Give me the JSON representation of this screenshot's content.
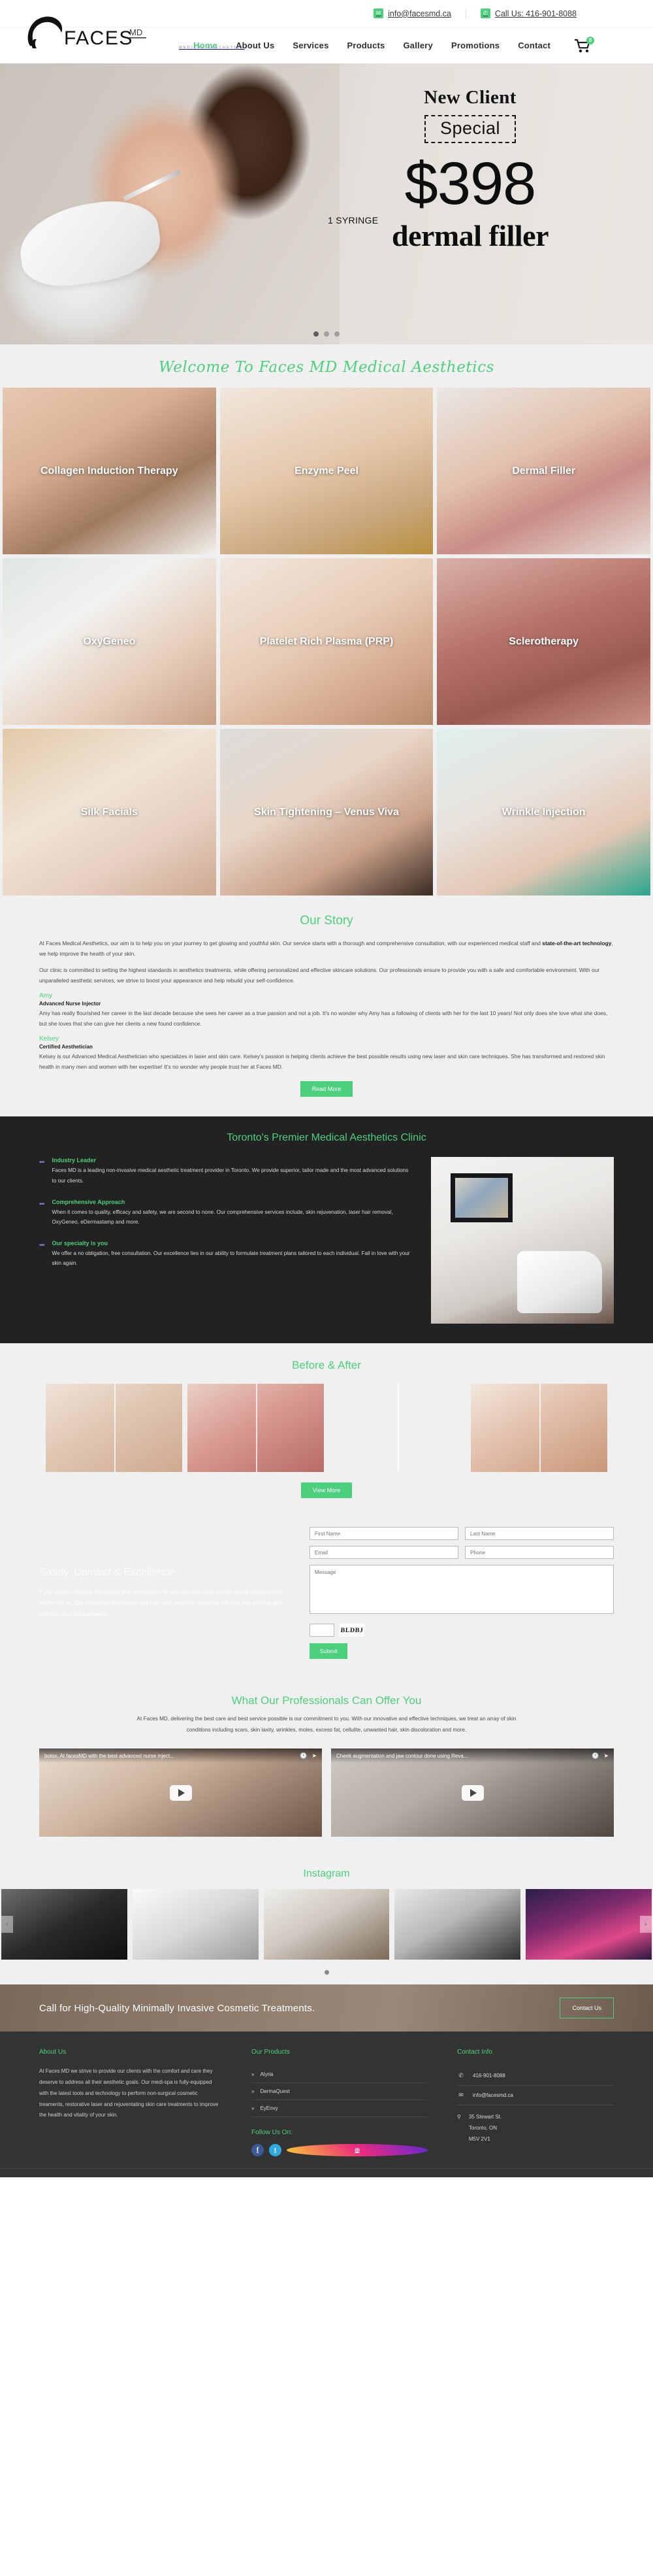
{
  "topbar": {
    "email": "info@facesmd.ca",
    "phone": "Call Us: 416-901-8088",
    "email_icon": "envelope-icon",
    "phone_icon": "phone-icon"
  },
  "brand": {
    "name": "FACES",
    "superscript": "MD",
    "tagline": "MEDICAL AESTHETICS"
  },
  "nav": {
    "items": [
      {
        "label": "Home",
        "active": true
      },
      {
        "label": "About Us",
        "active": false
      },
      {
        "label": "Services",
        "active": false
      },
      {
        "label": "Products",
        "active": false
      },
      {
        "label": "Gallery",
        "active": false
      },
      {
        "label": "Promotions",
        "active": false
      },
      {
        "label": "Contact",
        "active": false
      }
    ],
    "cart_count": "0"
  },
  "hero": {
    "kicker": "New Client",
    "special": "Special",
    "price": "$398",
    "syringe": "1 SYRINGE",
    "product": "dermal filler",
    "slides": 3,
    "active_slide": 1
  },
  "welcome": {
    "heading": "Welcome To Faces MD Medical Aesthetics"
  },
  "services": [
    {
      "label": "Collagen Induction Therapy"
    },
    {
      "label": "Enzyme Peel"
    },
    {
      "label": "Dermal Filler"
    },
    {
      "label": "OxyGeneo"
    },
    {
      "label": "Platelet Rich Plasma (PRP)"
    },
    {
      "label": "Sclerotherapy"
    },
    {
      "label": "Silk Facials"
    },
    {
      "label": "Skin Tightening – Venus Viva"
    },
    {
      "label": "Wrinkle Injection"
    }
  ],
  "story": {
    "title": "Our Story",
    "p1_a": "At Faces Medical Aesthetics, our aim is to help you on your journey to get glowing and youthful skin. Our service starts with a thorough and comprehensive consultation, with our experienced medical staff and ",
    "p1_b": "state-of-the-art technology",
    "p1_c": ", we help improve the health of your skin.",
    "p2": "Our clinic is committed to setting the highest standards in aesthetics treatments, while offering personalized and effective skincare solutions. Our professionals ensure to provide you with a safe and comfortable environment. With our unparalleled aesthetic services, we strive to boost your appearance and help rebuild your self-confidence.",
    "amy_name": "Amy",
    "amy_role": "Advanced Nurse Injector",
    "amy_bio": "Amy has really flourished her career in the last decade because she sees her career as a true passion and not a job. It's no wonder why Amy has a following of clients with her for the last 10 years! Not only does she love what she does, but she loves that she can give her clients a new found confidence.",
    "kelsey_name": "Kelsey",
    "kelsey_role": "Certified Aesthetician",
    "kelsey_bio": "Kelsey is our Advanced Medical Aesthetician who specializes in laser and skin care. Kelsey's passion is helping clients achieve the best possible results using new laser and skin care techniques. She has transformed and restored skin health in many men and women with her expertise! It's no wonder why people trust her at Faces MD.",
    "read_more": "Read More"
  },
  "premier": {
    "title": "Toronto's Premier Medical Aesthetics Clinic",
    "features": [
      {
        "heading": "Industry Leader",
        "body": "Faces MD is a leading non-invasive medical aesthetic treatment provider in Toronto. We provide superior, tailor made and the most advanced solutions to our clients."
      },
      {
        "heading": "Comprehensive Approach",
        "body": "When it comes to quality, efficacy and safety, we are second to none. Our comprehensive services include, skin rejuvenation, laser hair removal, OxyGeneo, eDermastamp and more."
      },
      {
        "heading": "Our specialty is you",
        "body": "We offer a no obligation, free consultation. Our excellence lies in our ability to formulate treatment plans tailored to each individual. Fall in love with your skin again."
      }
    ]
  },
  "before_after": {
    "title": "Before & After",
    "view_more": "View More",
    "cards": 4
  },
  "safety": {
    "title": "Safety, Comfort & Excellence",
    "body": "If you want to improve the texture and appearance of your skin and want to look young and beautiful, kindly visit us. Our innovative techniques and high-tech aesthetic expertise will help you achieve and maintain your natural beauty."
  },
  "form": {
    "first_name_placeholder": "First Name",
    "last_name_placeholder": "Last Name",
    "email_placeholder": "Email",
    "phone_placeholder": "Phone",
    "message_placeholder": "Message",
    "first_name_value": "",
    "last_name_value": "",
    "email_value": "",
    "phone_value": "",
    "message_value": "",
    "captcha_value": "",
    "captcha_text": "BLDBJ",
    "submit_label": "Submit"
  },
  "offer": {
    "title": "What Our Professionals Can Offer You",
    "body": "At Faces MD, delivering the best care and best service possible is our commitment to you. With our innovative and effective techniques, we treat an array of skin conditions including scars, skin laxity, wrinkles, moles, excess fat, cellulite, unwanted hair, skin discoloration and more.",
    "videos": [
      {
        "title": "botox, At facesMD with the best advanced nurse inject..."
      },
      {
        "title": "Cheek augmentation and jaw contour done using Reva..."
      }
    ]
  },
  "instagram": {
    "title": "Instagram",
    "prev_icon": "chevron-left-icon",
    "next_icon": "chevron-right-icon",
    "tiles": 5
  },
  "cta": {
    "text": "Call for High-Quality Minimally Invasive Cosmetic Treatments.",
    "button": "Contact Us"
  },
  "footer": {
    "about_title": "About Us",
    "about_body": "At Faces MD we strive to provide our clients with the comfort and care they deserve to address all their aesthetic goals. Our medi-spa is fully-equipped with the latest tools and technology to perform non-surgical cosmetic treaments, restorative laser and rejuventating skin care treatments to improve the health and vitality of your skin.",
    "products_title": "Our Products",
    "products": [
      "Alyria",
      "DermaQuest",
      "EyEnvy"
    ],
    "follow_title": "Follow Us On:",
    "socials": [
      {
        "name": "facebook-icon",
        "glyph": "f"
      },
      {
        "name": "twitter-icon",
        "glyph": "t"
      },
      {
        "name": "instagram-icon",
        "glyph": "◎"
      }
    ],
    "contact_title": "Contact Info",
    "phone": "416-901-8088",
    "email": "info@facesmd.ca",
    "address_line1": "35 Stewart St.",
    "address_line2": "Toronto, ON",
    "address_line3": "M5V 2V1",
    "phone_icon": "phone-icon",
    "email_icon": "envelope-icon",
    "pin_icon": "map-pin-icon"
  },
  "colors": {
    "accent": "#4cd07d",
    "dark": "#222222",
    "footer": "#333333",
    "page_bg": "#f0f0f0"
  }
}
